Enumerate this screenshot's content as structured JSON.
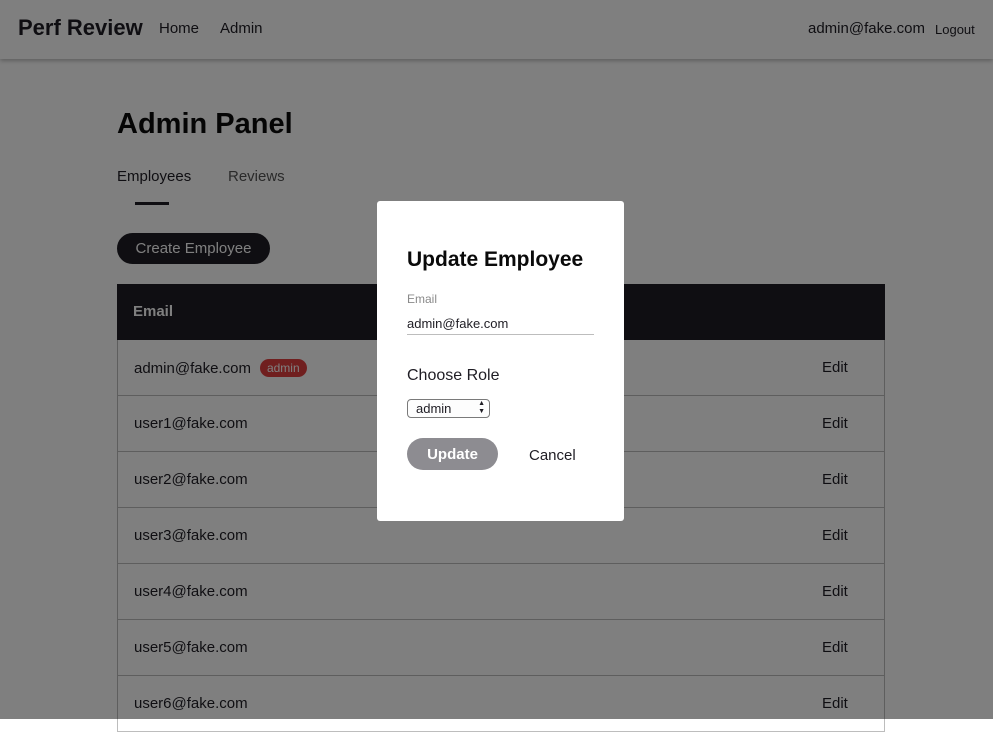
{
  "navbar": {
    "brand": "Perf Review",
    "links": [
      "Home",
      "Admin"
    ],
    "user_email": "admin@fake.com",
    "logout": "Logout"
  },
  "page": {
    "title": "Admin Panel",
    "tabs": [
      "Employees",
      "Reviews"
    ],
    "active_tab": "Employees",
    "create_button": "Create Employee"
  },
  "table": {
    "header": "Email",
    "rows": [
      {
        "email": "admin@fake.com",
        "badge": "admin",
        "action": "Edit"
      },
      {
        "email": "user1@fake.com",
        "action": "Edit"
      },
      {
        "email": "user2@fake.com",
        "action": "Edit"
      },
      {
        "email": "user3@fake.com",
        "action": "Edit"
      },
      {
        "email": "user4@fake.com",
        "action": "Edit"
      },
      {
        "email": "user5@fake.com",
        "action": "Edit"
      },
      {
        "email": "user6@fake.com",
        "action": "Edit"
      }
    ]
  },
  "modal": {
    "title": "Update Employee",
    "email_label": "Email",
    "email_value": "admin@fake.com",
    "role_label": "Choose Role",
    "role_selected": "admin",
    "update_button": "Update",
    "cancel_button": "Cancel"
  },
  "colors": {
    "dark": "#1f1d24",
    "badge": "#e03e3e",
    "overlay": "rgba(0,0,0,0.5)",
    "update_button": "#8d8c91"
  }
}
